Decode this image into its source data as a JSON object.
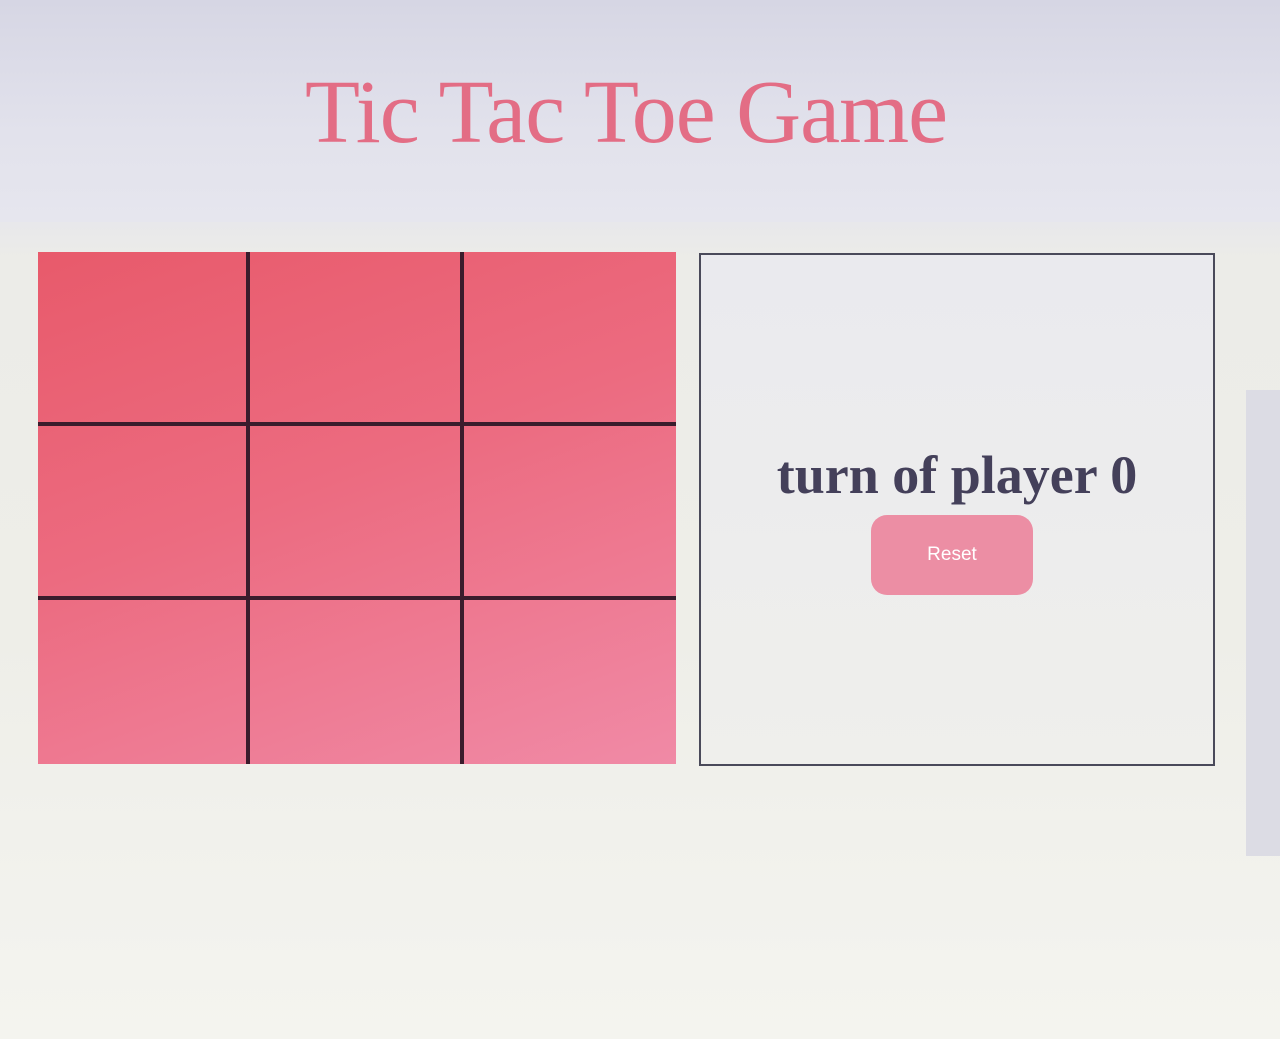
{
  "page": {
    "title": "Tic Tac Toe Game"
  },
  "board": {
    "cells": [
      "",
      "",
      "",
      "",
      "",
      "",
      "",
      "",
      ""
    ],
    "colors": {
      "fill_start": "#e85a6b",
      "fill_end": "#f08aa6",
      "grid_lines": "#3a1c2c"
    }
  },
  "status": {
    "turn_text": "turn of player 0"
  },
  "controls": {
    "reset_label": "Reset"
  },
  "colors": {
    "title": "#e36d85",
    "button": "#ec8ea4",
    "turn_text": "#44405a"
  }
}
